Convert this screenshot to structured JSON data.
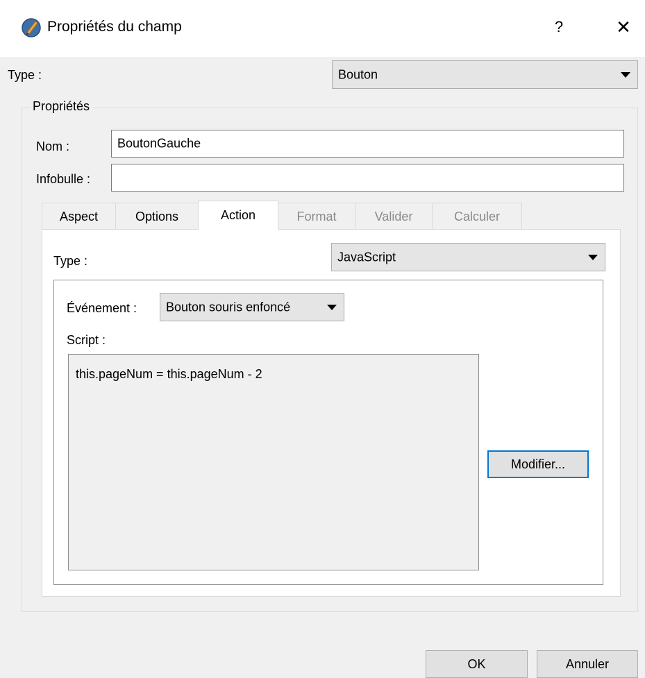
{
  "window": {
    "title": "Propriétés du champ",
    "help_label": "?",
    "close_label": "✕"
  },
  "form": {
    "type_label": "Type :",
    "type_value": "Bouton",
    "group_title": "Propriétés",
    "nom_label": "Nom :",
    "nom_value": "BoutonGauche",
    "infobulle_label": "Infobulle :",
    "infobulle_value": ""
  },
  "tabs": [
    {
      "label": "Aspect",
      "state": "normal"
    },
    {
      "label": "Options",
      "state": "normal"
    },
    {
      "label": "Action",
      "state": "active"
    },
    {
      "label": "Format",
      "state": "disabled"
    },
    {
      "label": "Valider",
      "state": "disabled"
    },
    {
      "label": "Calculer",
      "state": "disabled"
    }
  ],
  "action": {
    "type_label": "Type :",
    "type_value": "JavaScript",
    "event_label": "Événement :",
    "event_value": "Bouton souris enfoncé",
    "script_label": "Script :",
    "script_text": "this.pageNum = this.pageNum - 2",
    "modify_button": "Modifier..."
  },
  "footer": {
    "ok_label": "OK",
    "cancel_label": "Annuler"
  },
  "colors": {
    "accent": "#0078d7",
    "window_bg": "#f0f0f0"
  },
  "icons": {
    "app": "pdf-editor-app-icon",
    "combo_arrow": "chevron-down-icon",
    "close": "close-icon"
  }
}
